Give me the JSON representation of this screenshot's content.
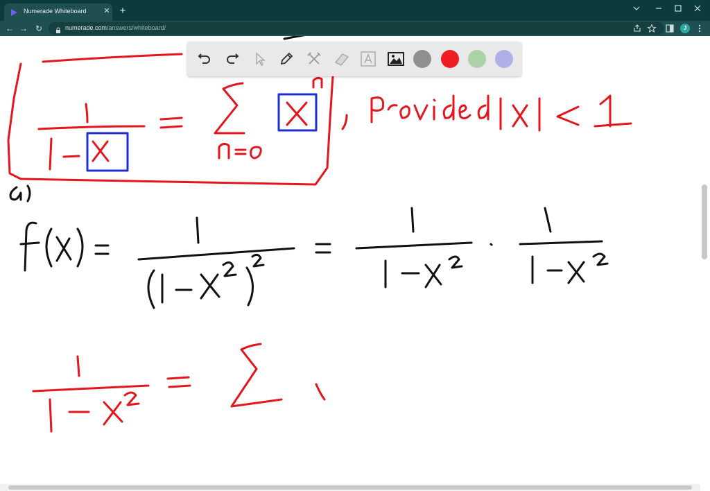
{
  "browser": {
    "tab_title": "Numerade Whiteboard",
    "tab_close": "✕",
    "new_tab": "+",
    "url_host": "numerade.com",
    "url_path": "/answers/whiteboard/",
    "profile_initial": "J",
    "nav_back": "←",
    "nav_forward": "→",
    "nav_reload": "↻"
  },
  "palette": {
    "tools": [
      "undo-icon",
      "redo-icon",
      "pointer-icon",
      "pen-icon",
      "tools-icon",
      "eraser-icon",
      "text-icon",
      "image-icon"
    ],
    "colors": [
      {
        "name": "gray",
        "hex": "#8f8f8f"
      },
      {
        "name": "red",
        "hex": "#ee1d23",
        "selected": true
      },
      {
        "name": "green",
        "hex": "#acd3a7"
      },
      {
        "name": "purple",
        "hex": "#b1b0e6"
      }
    ]
  },
  "ink_colors": {
    "red": "#e3161e",
    "black": "#111111",
    "blue": "#1f2fc9"
  },
  "handwriting": {
    "boxed_formula": "1 / (1 − x) = Σ_{n=0} x^n",
    "condition": ", Provided |x| < 1",
    "part_label": "a)",
    "line_1": "f(x) = 1 / (1 − x²)² = 1 / (1 − x²) · 1 / (1 − x²)",
    "line_2": "1 / (1 − x²) = Σ"
  }
}
